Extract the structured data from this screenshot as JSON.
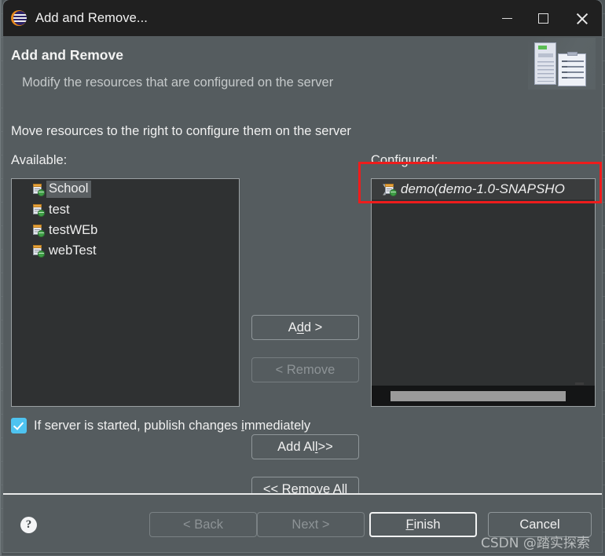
{
  "window": {
    "title": "Add and Remove...",
    "icon": "eclipse-logo",
    "controls": {
      "minimize": "minimize-icon",
      "maximize": "maximize-icon",
      "close": "close-icon"
    }
  },
  "banner": {
    "title": "Add and Remove",
    "subtitle": "Modify the resources that are configured on the server",
    "art": "server-and-document-illustration"
  },
  "main": {
    "instruction": "Move resources to the right to configure them on the server",
    "available": {
      "label": "Available:",
      "items": [
        {
          "name": "School",
          "selected": true
        },
        {
          "name": "test",
          "selected": false
        },
        {
          "name": "testWEb",
          "selected": false
        },
        {
          "name": "webTest",
          "selected": false
        }
      ]
    },
    "configured": {
      "label": "Configured:",
      "items": [
        {
          "name": "demo(demo-1.0-SNAPSHO",
          "expandable": true,
          "italic": true
        }
      ],
      "scrollbar": "horizontal"
    },
    "transfer_buttons": [
      {
        "id": "add",
        "label": "Add >",
        "pre": "A",
        "mnemonic": "d",
        "post": "d >",
        "enabled": true
      },
      {
        "id": "remove",
        "label": "< Remove",
        "pre": "< Remove",
        "mnemonic": "",
        "post": "",
        "enabled": false
      },
      {
        "id": "add-all",
        "label": "Add All >>",
        "pre": "Add Al",
        "mnemonic": "l",
        "post": " >>",
        "enabled": true
      },
      {
        "id": "remove-all",
        "label": "<< Remove All",
        "pre": "<< Re",
        "mnemonic": "m",
        "post": "ove All",
        "enabled": true
      }
    ],
    "publish_checkbox": {
      "checked": true,
      "pre": "If server is started, publish changes ",
      "mnemonic": "i",
      "post": "mmediately"
    }
  },
  "footer": {
    "help": "?",
    "buttons": [
      {
        "id": "back",
        "label": "< Back",
        "pre": "< Back",
        "mnemonic": "",
        "post": "",
        "enabled": false,
        "default": false
      },
      {
        "id": "next",
        "label": "Next >",
        "pre": "Next >",
        "mnemonic": "",
        "post": "",
        "enabled": false,
        "default": false
      },
      {
        "id": "finish",
        "label": "Finish",
        "pre": "",
        "mnemonic": "F",
        "post": "inish",
        "enabled": true,
        "default": true
      },
      {
        "id": "cancel",
        "label": "Cancel",
        "pre": "Cancel",
        "mnemonic": "",
        "post": "",
        "enabled": true,
        "default": false
      }
    ]
  },
  "annotation": {
    "type": "red-rectangle-highlight",
    "color": "#ee1c1c",
    "targets": "configured-list-first-item"
  },
  "watermark": "CSDN @踏实探索"
}
